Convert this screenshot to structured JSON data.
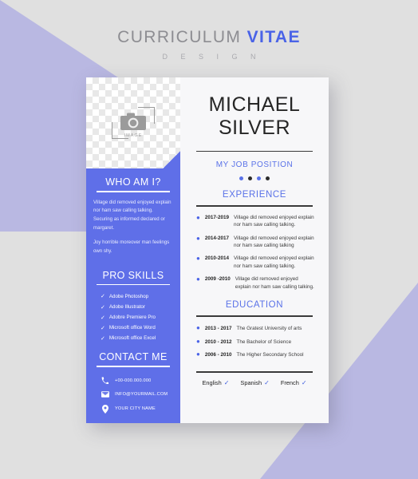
{
  "header": {
    "title_main": "CURRICULUM",
    "title_accent": "VITAE",
    "subtitle": "D E S I G N"
  },
  "colors": {
    "accent_blue": "#5a72e8",
    "sidebar_blue": "#5f6fe8",
    "background_gray": "#e0e0e0",
    "background_purple": "#b9b8e2",
    "card_background": "#f7f7f9",
    "dark_text": "#262626"
  },
  "photo": {
    "icon": "camera-icon",
    "caption": "IMAGE"
  },
  "sidebar": {
    "about": {
      "heading": "WHO AM I?",
      "paragraphs": [
        "Village did removed enjoyed explain nor ham saw calling talking. Securing as informed declared or margaret.",
        "Joy horrible moreover man feelings own shy."
      ]
    },
    "skills": {
      "heading": "PRO SKILLS",
      "items": [
        "Adobe Photoshop",
        "Adobe Illustrator",
        "Adobre Premiere Pro",
        "Microsoft office Word",
        "Microsoft office Excel"
      ],
      "check_glyph": "✓"
    },
    "contact": {
      "heading": "CONTACT ME",
      "items": [
        {
          "icon": "phone-icon",
          "value": "+00-000.000.000"
        },
        {
          "icon": "envelope-icon",
          "value": "INFO@YOURMAIL.COM"
        },
        {
          "icon": "location-pin-icon",
          "value": "YOUR CITY NAME"
        }
      ]
    }
  },
  "main": {
    "name_first": "MICHAEL",
    "name_last": "SILVER",
    "job_position": "MY JOB POSITION",
    "dots": [
      "blue",
      "dark",
      "blue",
      "dark"
    ],
    "experience": {
      "heading": "EXPERIENCE",
      "entries": [
        {
          "date": "2017-2019",
          "text": "Village did removed enjoyed explain nor ham saw calling talking."
        },
        {
          "date": "2014-2017",
          "text": "Village did removed enjoyed explain nor ham saw calling talking"
        },
        {
          "date": "2010-2014",
          "text": "Village did removed enjoyed explain nor ham saw calling talking."
        },
        {
          "date": "2009 -2010",
          "text": "Village did removed enjoyed explain nor ham saw calling talking."
        }
      ]
    },
    "education": {
      "heading": "EDUCATION",
      "entries": [
        {
          "date": "2013 - 2017",
          "text": "The Gratest University of arts"
        },
        {
          "date": "2010 - 2012",
          "text": "The Bachelor of Science"
        },
        {
          "date": "2006 - 2010",
          "text": "The Higher Secondary School"
        }
      ]
    },
    "languages": {
      "items": [
        "English",
        "Spanish",
        "French"
      ],
      "check_glyph": "✓"
    }
  }
}
